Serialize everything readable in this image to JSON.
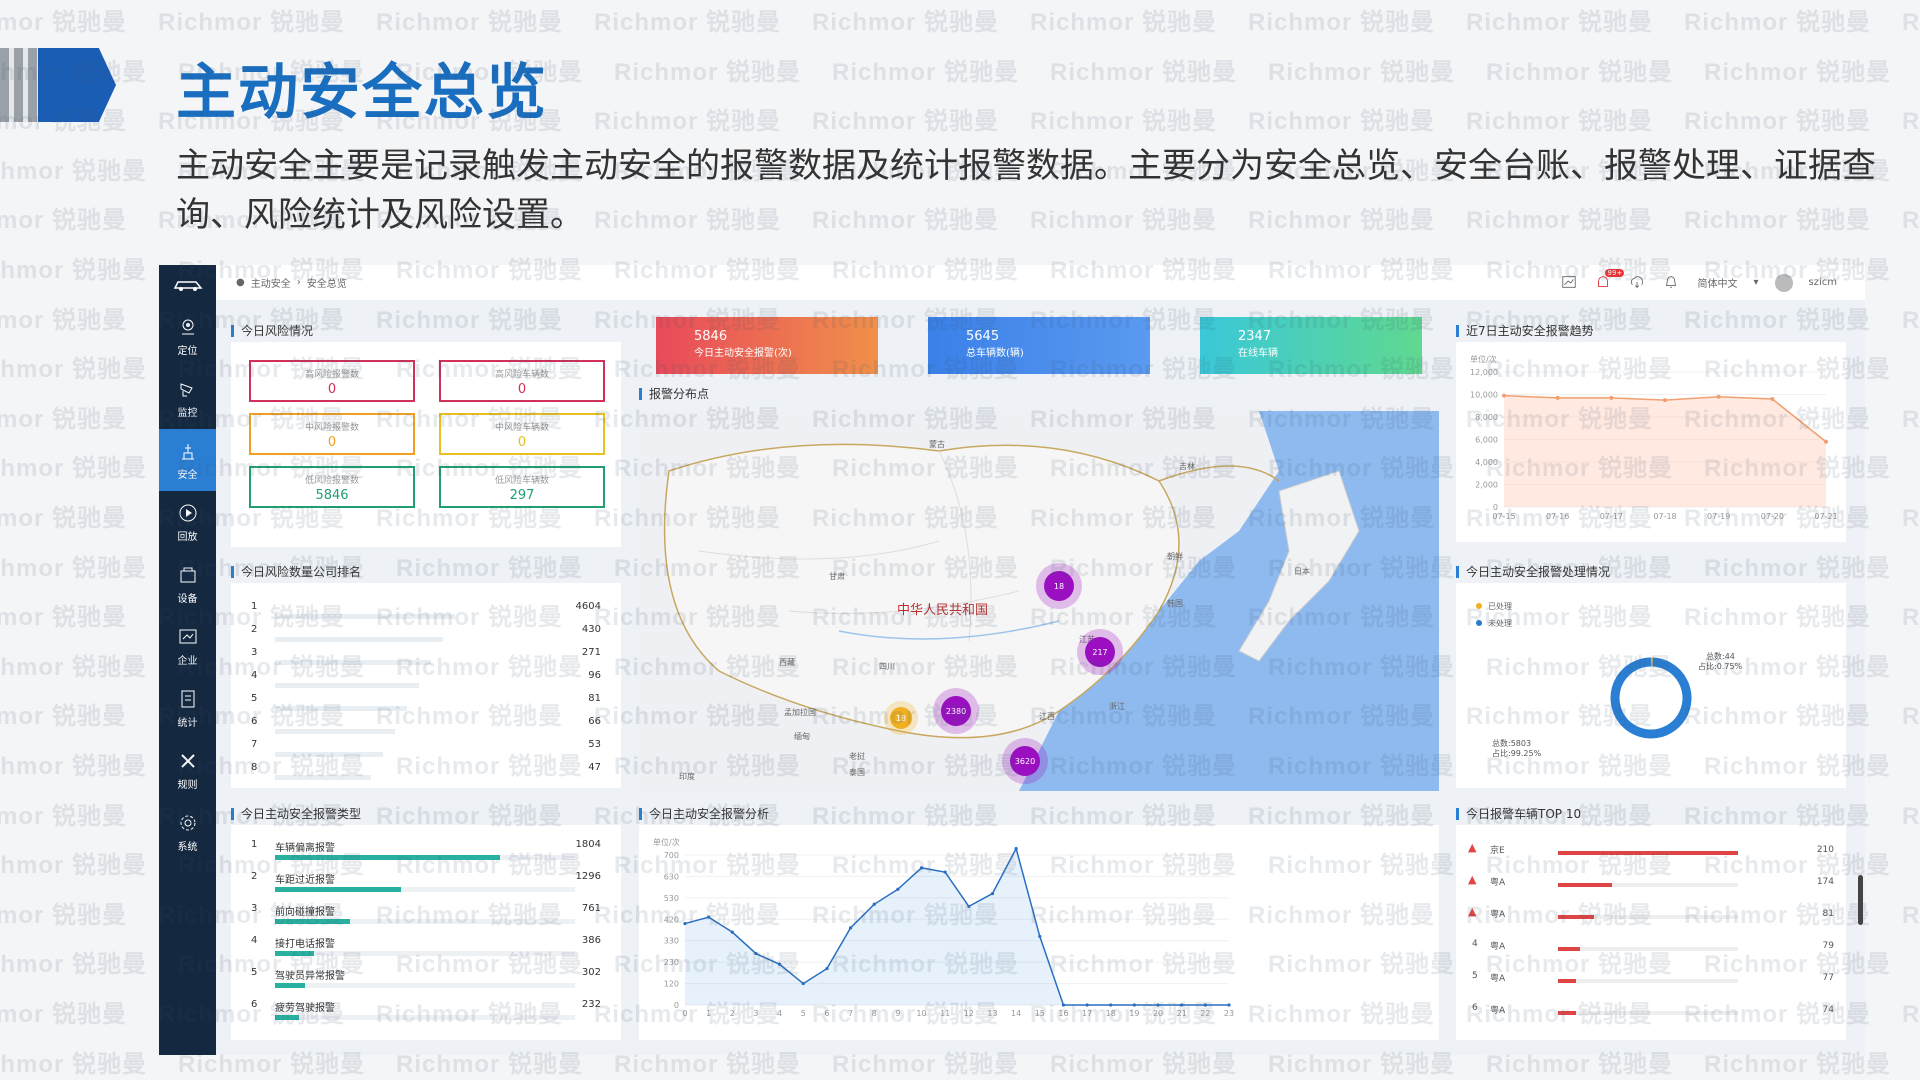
{
  "slide": {
    "title": "主动安全总览",
    "description": "主动安全主要是记录触发主动安全的报警数据及统计报警数据。主要分为安全总览、安全台账、报警处理、证据查询、风险统计及风险设置。",
    "watermark": "Richmor 锐驰曼"
  },
  "sidebar": {
    "items": [
      {
        "label": "定位",
        "icon": "location-icon"
      },
      {
        "label": "监控",
        "icon": "camera-icon"
      },
      {
        "label": "安全",
        "icon": "safety-icon"
      },
      {
        "label": "回放",
        "icon": "playback-icon"
      },
      {
        "label": "设备",
        "icon": "device-icon"
      },
      {
        "label": "企业",
        "icon": "enterprise-icon"
      },
      {
        "label": "统计",
        "icon": "statistics-icon"
      },
      {
        "label": "规则",
        "icon": "rules-icon"
      },
      {
        "label": "系统",
        "icon": "system-icon"
      }
    ]
  },
  "topbar": {
    "breadcrumb": [
      "主动安全",
      "安全总览"
    ],
    "badge": "99+",
    "language": "简体中文",
    "user": "szicm"
  },
  "risk_today": {
    "title": "今日风险情况",
    "boxes": [
      {
        "label": "高风险报警数",
        "value": "0",
        "color": "#d0305a"
      },
      {
        "label": "高风险车辆数",
        "value": "0",
        "color": "#d0305a"
      },
      {
        "label": "中风险报警数",
        "value": "0",
        "color": "#f0a020"
      },
      {
        "label": "中风险车辆数",
        "value": "0",
        "color": "#e8c020"
      },
      {
        "label": "低风险报警数",
        "value": "5846",
        "color": "#20a070"
      },
      {
        "label": "低风险车辆数",
        "value": "297",
        "color": "#20a070"
      }
    ]
  },
  "kpis": [
    {
      "number": "5846",
      "label": "今日主动安全报警(次)",
      "from": "#e84a5a",
      "to": "#f0904a"
    },
    {
      "number": "5645",
      "label": "总车辆数(辆)",
      "from": "#3a80e8",
      "to": "#5a9af0"
    },
    {
      "number": "2347",
      "label": "在线车辆",
      "from": "#3ac8d8",
      "to": "#60d890"
    }
  ],
  "map": {
    "title": "报警分布点",
    "country_label": "中华人民共和国",
    "places": [
      "蒙古",
      "日本",
      "韩国",
      "朝鲜",
      "老挝",
      "缅甸",
      "泰国",
      "印度",
      "孟加拉国",
      "西藏",
      "四川",
      "吉林",
      "江苏",
      "浙江",
      "江西",
      "甘肃"
    ],
    "bubbles": [
      {
        "value": "18",
        "color": "#9a10c0"
      },
      {
        "value": "217",
        "color": "#9a10c0"
      },
      {
        "value": "2380",
        "color": "#9a10c0"
      },
      {
        "value": "3620",
        "color": "#9a10c0"
      },
      {
        "value": "18",
        "color": "#f0b020"
      }
    ]
  },
  "trend7": {
    "title": "近7日主动安全报警趋势",
    "unit": "单位/次",
    "y_ticks": [
      "12,000",
      "10,000",
      "8,000",
      "6,000",
      "4,000",
      "2,000",
      "0"
    ],
    "x_ticks": [
      "07-15",
      "07-16",
      "07-17",
      "07-18",
      "07-19",
      "07-20",
      "07-21"
    ]
  },
  "company_rank": {
    "title": "今日风险数量公司排名",
    "rows": [
      {
        "rank": "1",
        "value": "4604"
      },
      {
        "rank": "2",
        "value": "430"
      },
      {
        "rank": "3",
        "value": "271"
      },
      {
        "rank": "4",
        "value": "96"
      },
      {
        "rank": "5",
        "value": "81"
      },
      {
        "rank": "6",
        "value": "66"
      },
      {
        "rank": "7",
        "value": "53"
      },
      {
        "rank": "8",
        "value": "47"
      }
    ]
  },
  "handling": {
    "title": "今日主动安全报警处理情况",
    "legend": [
      "已处理",
      "未处理"
    ],
    "legend_colors": [
      "#f0b020",
      "#2a7fd4"
    ],
    "label_a": "总数:44",
    "label_a2": "占比:0.75%",
    "label_b": "总数:5803",
    "label_b2": "占比:99.25%"
  },
  "alarm_types": {
    "title": "今日主动安全报警类型",
    "rows": [
      {
        "rank": "1",
        "name": "车辆偏离报警",
        "value": "1804",
        "fill": 0.75
      },
      {
        "rank": "2",
        "name": "车距过近报警",
        "value": "1296",
        "fill": 0.42
      },
      {
        "rank": "3",
        "name": "前向碰撞报警",
        "value": "761",
        "fill": 0.25
      },
      {
        "rank": "4",
        "name": "接打电话报警",
        "value": "386",
        "fill": 0.13
      },
      {
        "rank": "5",
        "name": "驾驶员异常报警",
        "value": "302",
        "fill": 0.1
      },
      {
        "rank": "6",
        "name": "疲劳驾驶报警",
        "value": "232",
        "fill": 0.08
      }
    ]
  },
  "analysis": {
    "title": "今日主动安全报警分析",
    "unit": "单位/次",
    "y_ticks": [
      "700",
      "630",
      "530",
      "420",
      "330",
      "230",
      "120",
      "0"
    ],
    "x_ticks": [
      "0",
      "1",
      "2",
      "3",
      "4",
      "5",
      "6",
      "7",
      "8",
      "9",
      "10",
      "11",
      "12",
      "13",
      "14",
      "15",
      "16",
      "17",
      "18",
      "19",
      "20",
      "21",
      "22",
      "23"
    ]
  },
  "top10": {
    "title": "今日报警车辆TOP 10",
    "rows": [
      {
        "rank": "1",
        "plate": "京E",
        "value": "210",
        "fill": 1.0
      },
      {
        "rank": "2",
        "plate": "粤A",
        "value": "174",
        "fill": 0.3
      },
      {
        "rank": "3",
        "plate": "粤A",
        "value": "81",
        "fill": 0.2
      },
      {
        "rank": "4",
        "plate": "粤A",
        "value": "79",
        "fill": 0.12
      },
      {
        "rank": "5",
        "plate": "粤A",
        "value": "77",
        "fill": 0.1
      },
      {
        "rank": "6",
        "plate": "粤A",
        "value": "74",
        "fill": 0.1
      }
    ]
  },
  "chart_data": [
    {
      "type": "area",
      "title": "近7日主动安全报警趋势",
      "x": [
        "07-15",
        "07-16",
        "07-17",
        "07-18",
        "07-19",
        "07-20",
        "07-21"
      ],
      "values": [
        9900,
        9700,
        9700,
        9500,
        9800,
        9600,
        5800
      ],
      "ylim": [
        0,
        12000
      ],
      "ylabel": "单位/次"
    },
    {
      "type": "pie",
      "title": "今日主动安全报警处理情况",
      "categories": [
        "已处理",
        "未处理"
      ],
      "values": [
        44,
        5803
      ]
    },
    {
      "type": "area",
      "title": "今日主动安全报警分析",
      "x": [
        "0",
        "1",
        "2",
        "3",
        "4",
        "5",
        "6",
        "7",
        "8",
        "9",
        "10",
        "11",
        "12",
        "13",
        "14",
        "15",
        "16",
        "17",
        "18",
        "19",
        "20",
        "21",
        "22",
        "23"
      ],
      "values": [
        380,
        410,
        340,
        240,
        190,
        100,
        170,
        360,
        470,
        540,
        640,
        620,
        460,
        520,
        730,
        320,
        0,
        0,
        0,
        0,
        0,
        0,
        0,
        0
      ],
      "ylim": [
        0,
        700
      ],
      "ylabel": "单位/次"
    }
  ]
}
